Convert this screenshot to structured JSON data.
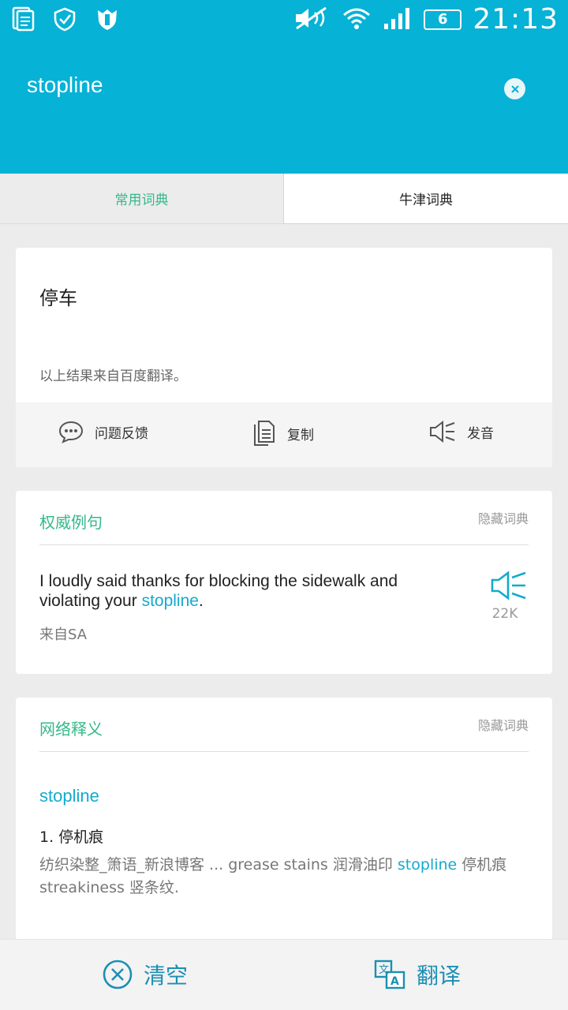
{
  "status": {
    "time": "21:13",
    "battery": "6"
  },
  "search": {
    "query": "stopline"
  },
  "tabs": [
    {
      "label": "常用词典"
    },
    {
      "label": "牛津词典"
    }
  ],
  "result": {
    "translation": "停车",
    "source_note": "以上结果来自百度翻译。",
    "actions": {
      "feedback": "问题反馈",
      "copy": "复制",
      "pronounce": "发音"
    }
  },
  "examples": {
    "title": "权威例句",
    "hide_label": "隐藏词典",
    "sentence_before": "I loudly said thanks for blocking the sidewalk and violating your ",
    "sentence_keyword": "stopline",
    "sentence_after": ".",
    "source": "来自SA",
    "count": "22K"
  },
  "web": {
    "title": "网络释义",
    "hide_label": "隐藏词典",
    "word": "stopline",
    "definition": "1. 停机痕",
    "text_before": "纺织染整_箫语_新浪博客 ... grease stains 润滑油印 ",
    "text_keyword": "stopline",
    "text_after": " 停机痕 streakiness 竖条纹."
  },
  "bottom": {
    "clear": "清空",
    "translate": "翻译"
  },
  "colors": {
    "header": "#06b2d6",
    "accent_green": "#35b98a",
    "link_blue": "#14aace"
  }
}
